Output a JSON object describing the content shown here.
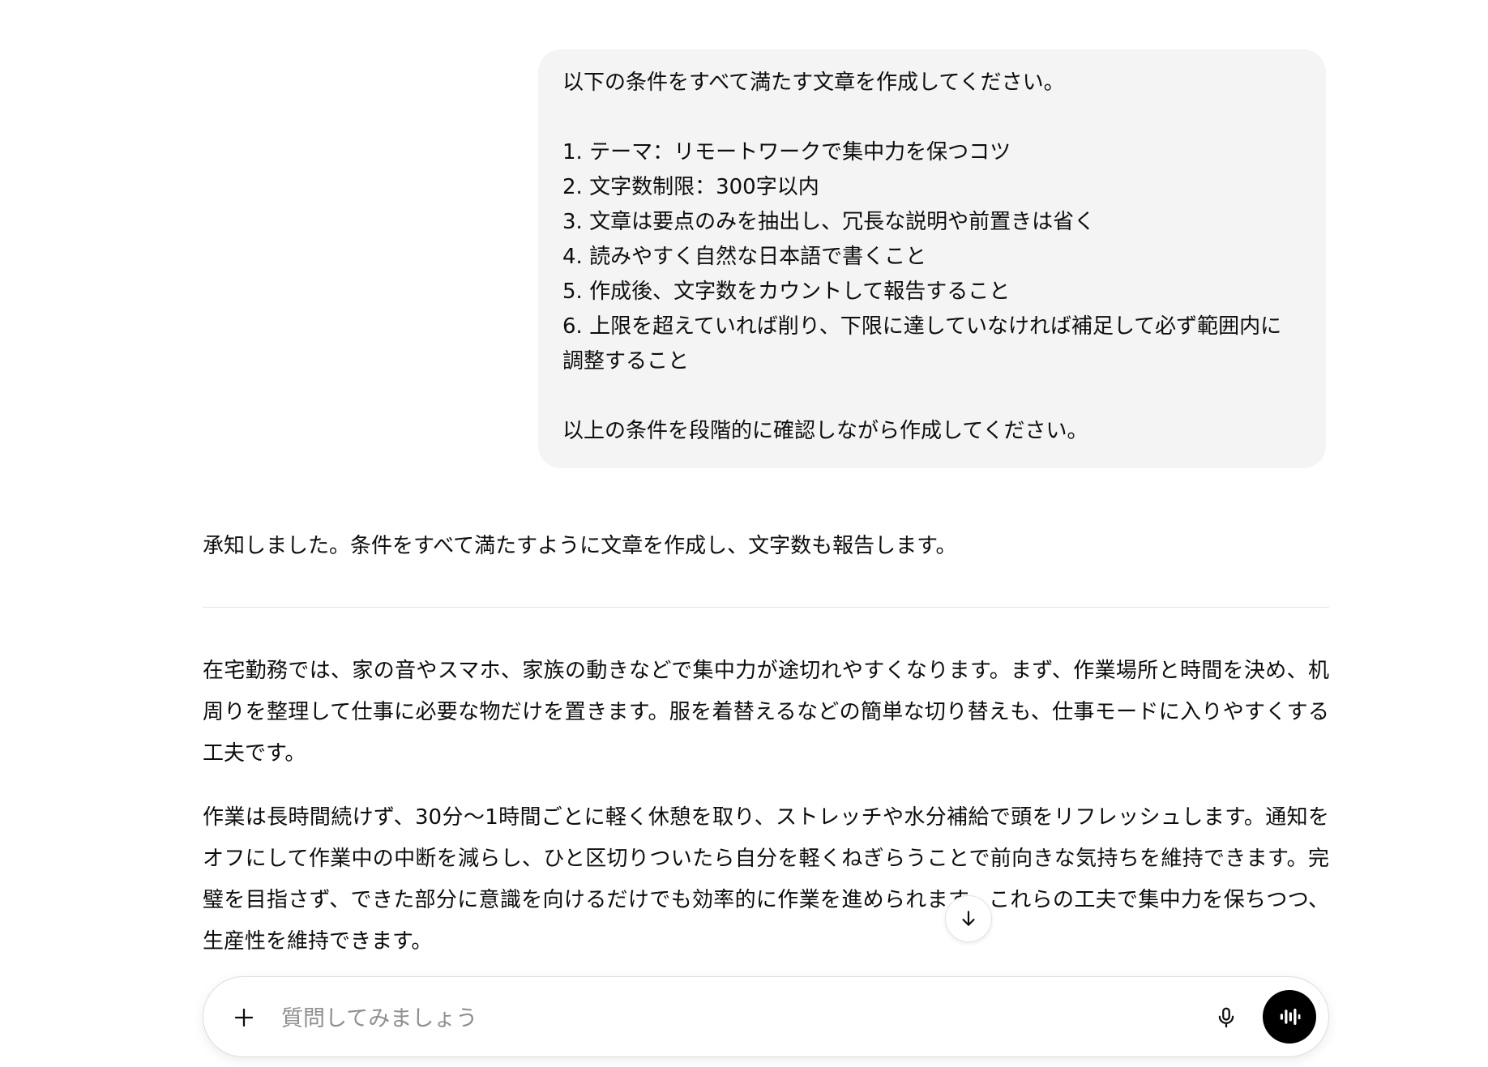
{
  "user_message": {
    "intro": "以下の条件をすべて満たす文章を作成してください。",
    "items": [
      "1. テーマ：リモートワークで集中力を保つコツ",
      "2. 文字数制限：300字以内",
      "3. 文章は要点のみを抽出し、冗長な説明や前置きは省く",
      "4. 読みやすく自然な日本語で書くこと",
      "5. 作成後、文字数をカウントして報告すること",
      "6. 上限を超えていれば削り、下限に達していなければ補足して必ず範囲内に調整すること"
    ],
    "closing": "以上の条件を段階的に確認しながら作成してください。"
  },
  "assistant": {
    "intro": "承知しました。条件をすべて満たすように文章を作成し、文字数も報告します。",
    "paragraphs": [
      "在宅勤務では、家の音やスマホ、家族の動きなどで集中力が途切れやすくなります。まず、作業場所と時間を決め、机周りを整理して仕事に必要な物だけを置きます。服を着替えるなどの簡単な切り替えも、仕事モードに入りやすくする工夫です。",
      "作業は長時間続けず、30分〜1時間ごとに軽く休憩を取り、ストレッチや水分補給で頭をリフレッシュします。通知をオフにして作業中の中断を減らし、ひと区切りついたら自分を軽くねぎらうことで前向きな気持ちを維持できます。完璧を目指さず、できた部分に意識を向けるだけでも効率的に作業を進められます。これらの工夫で集中力を保ちつつ、生産性を維持できます。"
    ]
  },
  "composer": {
    "placeholder": "質問してみましょう",
    "icons": {
      "add": "plus-icon",
      "mic": "microphone-icon",
      "voice": "voice-mode-icon",
      "scroll": "arrow-down-icon"
    }
  }
}
